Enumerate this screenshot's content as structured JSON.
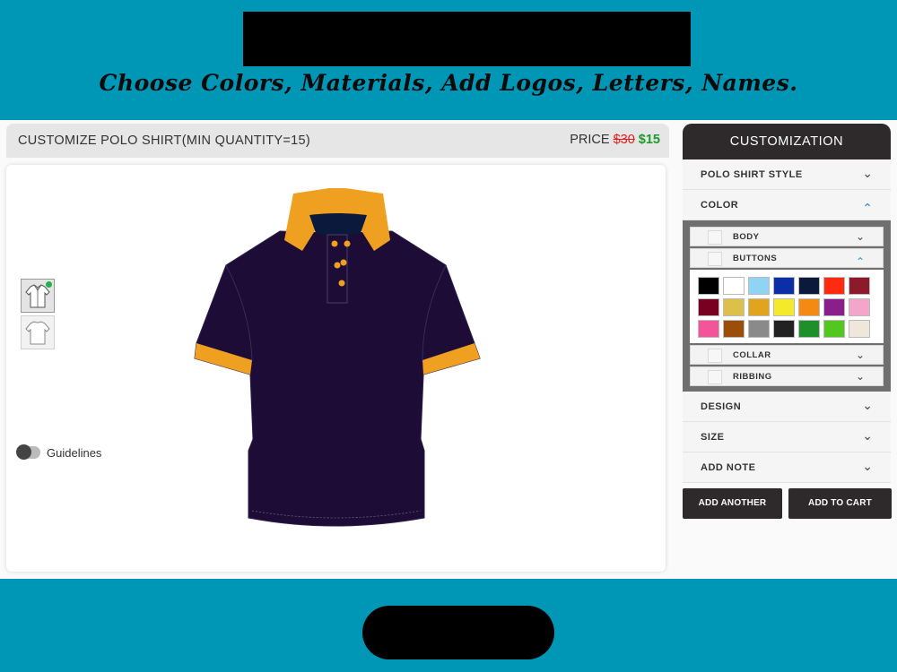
{
  "tagline": "Choose Colors, Materials, Add Logos, Letters, Names.",
  "header": {
    "title": "CUSTOMIZE POLO SHIRT(MIN QUANTITY=15)",
    "price_label": "PRICE",
    "old_price": "$30",
    "new_price": "$15"
  },
  "canvas": {
    "guidelines_label": "Guidelines",
    "views": [
      "front-view",
      "back-view"
    ]
  },
  "sidebar": {
    "title": "CUSTOMIZATION",
    "sections": [
      {
        "label": "POLO SHIRT STYLE",
        "state": "collapsed"
      },
      {
        "label": "COLOR",
        "state": "expanded"
      },
      {
        "label": "DESIGN",
        "state": "collapsed"
      },
      {
        "label": "SIZE",
        "state": "collapsed"
      },
      {
        "label": "ADD NOTE",
        "state": "collapsed"
      }
    ],
    "color_parts": [
      {
        "label": "BODY",
        "state": "collapsed"
      },
      {
        "label": "BUTTONS",
        "state": "expanded"
      },
      {
        "label": "COLLAR",
        "state": "collapsed"
      },
      {
        "label": "RIBBING",
        "state": "collapsed"
      }
    ],
    "swatches": [
      "#000000",
      "#ffffff",
      "#8fd4f5",
      "#0a2fa8",
      "#0b1a3c",
      "#ff2a0f",
      "#8c1a2b",
      "#7a0022",
      "#dcc04a",
      "#e0a51c",
      "#f4ea2a",
      "#f48a12",
      "#8a1e8c",
      "#f3a6c7",
      "#f4549a",
      "#9a4e0a",
      "#8a8a8a",
      "#222222",
      "#1f8f2a",
      "#52c81e",
      "#efe8da"
    ],
    "add_another_label": "ADD ANOTHER",
    "add_to_cart_label": "ADD TO CART"
  },
  "colors": {
    "brand_bg": "#0096b6",
    "shirt_body": "#1c0c36",
    "shirt_trim": "#f0a020",
    "dark_panel": "#2e2a2b"
  }
}
